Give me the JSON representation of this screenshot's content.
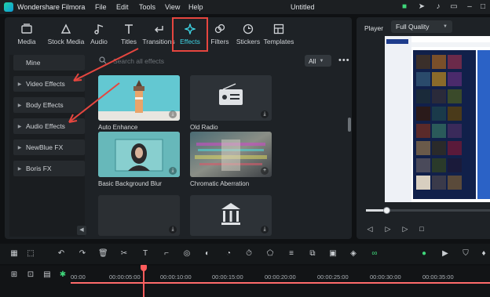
{
  "titlebar": {
    "app_name": "Wondershare Filmora",
    "menus": [
      "File",
      "Edit",
      "Tools",
      "View",
      "Help"
    ],
    "window_title": "Untitled"
  },
  "tabs": [
    {
      "label": "Media",
      "icon": "media-icon"
    },
    {
      "label": "Stock Media",
      "icon": "stock-media-icon"
    },
    {
      "label": "Audio",
      "icon": "music-note-icon"
    },
    {
      "label": "Titles",
      "icon": "text-t-icon"
    },
    {
      "label": "Transitions",
      "icon": "transition-arrow-icon"
    },
    {
      "label": "Effects",
      "icon": "sparkle-icon",
      "active": true
    },
    {
      "label": "Filters",
      "icon": "filter-circles-icon"
    },
    {
      "label": "Stickers",
      "icon": "sticker-icon"
    },
    {
      "label": "Templates",
      "icon": "template-icon"
    }
  ],
  "categories": [
    "Mine",
    "Video Effects",
    "Body Effects",
    "Audio Effects",
    "NewBlue FX",
    "Boris FX"
  ],
  "search": {
    "placeholder": "Search all effects",
    "filter_value": "All"
  },
  "effects": [
    {
      "label": "Auto Enhance"
    },
    {
      "label": "Old Radio"
    },
    {
      "label": "Basic Background Blur"
    },
    {
      "label": "Chromatic Aberration"
    },
    {
      "label": ""
    },
    {
      "label": ""
    }
  ],
  "player": {
    "label": "Player",
    "quality": "Full Quality",
    "progress": 0.17
  },
  "timeline": {
    "ticks": [
      "00:00",
      "00:00:05:00",
      "00:00:10:00",
      "00:00:15:00",
      "00:00:20:00",
      "00:00:25:00",
      "00:00:30:00",
      "00:00:35:00"
    ]
  },
  "colors": {
    "accent": "#3fd6e6",
    "highlight_box": "#e6463f",
    "annotation_arrow": "#e6463f",
    "playhead": "#ff5c5c"
  }
}
